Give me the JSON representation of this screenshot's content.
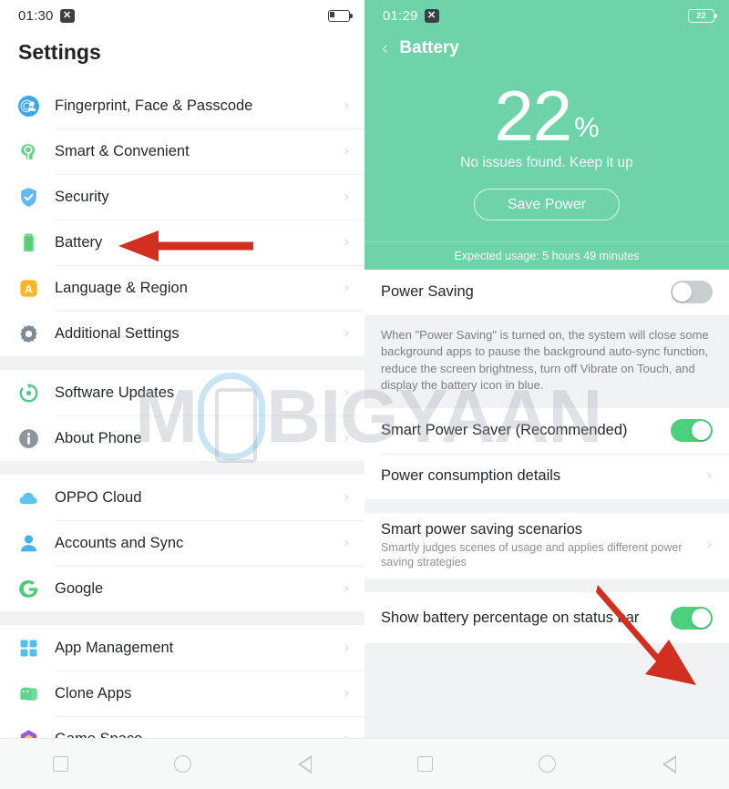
{
  "watermark": {
    "text_before": "M",
    "text_after": "BIGYAAN"
  },
  "left_screen": {
    "status_bar": {
      "time": "01:30",
      "icon": "close-x-icon",
      "battery_icon": "battery-low-icon"
    },
    "title": "Settings",
    "groups": [
      {
        "items": [
          {
            "label": "Fingerprint, Face & Passcode",
            "icon": "fingerprint-face-icon",
            "chevron": "›"
          },
          {
            "label": "Smart & Convenient",
            "icon": "smart-convenient-icon",
            "chevron": "›"
          },
          {
            "label": "Security",
            "icon": "shield-icon",
            "chevron": "›"
          },
          {
            "label": "Battery",
            "icon": "battery-icon",
            "chevron": "›"
          },
          {
            "label": "Language & Region",
            "icon": "language-icon",
            "chevron": "›"
          },
          {
            "label": "Additional Settings",
            "icon": "gear-icon",
            "chevron": "›"
          }
        ]
      },
      {
        "items": [
          {
            "label": "Software Updates",
            "icon": "refresh-icon",
            "chevron": "›"
          },
          {
            "label": "About Phone",
            "icon": "info-icon",
            "chevron": "›"
          }
        ]
      },
      {
        "items": [
          {
            "label": "OPPO Cloud",
            "icon": "cloud-icon",
            "chevron": "›"
          },
          {
            "label": "Accounts and Sync",
            "icon": "account-icon",
            "chevron": "›"
          },
          {
            "label": "Google",
            "icon": "google-icon",
            "chevron": "›"
          }
        ]
      },
      {
        "items": [
          {
            "label": "App Management",
            "icon": "app-grid-icon",
            "chevron": "›"
          },
          {
            "label": "Clone Apps",
            "icon": "clone-apps-icon",
            "chevron": "›"
          },
          {
            "label": "Game Space",
            "icon": "game-space-icon",
            "chevron": "›"
          }
        ]
      }
    ],
    "nav": {
      "recents": "recents-square-icon",
      "home": "home-circle-icon",
      "back": "back-triangle-icon"
    }
  },
  "right_screen": {
    "status_bar": {
      "time": "01:29",
      "icon": "close-x-icon",
      "battery_level": "22"
    },
    "header": {
      "back": "‹",
      "title": "Battery"
    },
    "hero": {
      "percent": "22",
      "percent_symbol": "%",
      "subtitle": "No issues found. Keep it up",
      "button_label": "Save Power",
      "expected_usage": "Expected usage: 5 hours 49 minutes",
      "bg_color": "#6ed3a9"
    },
    "rows": [
      {
        "label": "Power Saving",
        "control": "toggle",
        "state": "off"
      }
    ],
    "description": "When \"Power Saving\" is turned on, the system will close some background apps to pause the background auto-sync function, reduce the screen brightness, turn off Vibrate on Touch, and display the battery icon in blue.",
    "rows2": [
      {
        "label": "Smart Power Saver (Recommended)",
        "control": "toggle",
        "state": "on"
      },
      {
        "label": "Power consumption details",
        "control": "chevron",
        "chevron": "›"
      }
    ],
    "rows3": [
      {
        "label": "Smart power saving scenarios",
        "sub": "Smartly judges scenes of usage and applies different power saving strategies",
        "control": "chevron",
        "chevron": "›"
      }
    ],
    "rows4": [
      {
        "label": "Show battery percentage on status bar",
        "control": "toggle",
        "state": "on"
      }
    ],
    "nav": {
      "recents": "recents-square-icon",
      "home": "home-circle-icon",
      "back": "back-triangle-icon"
    }
  },
  "annotations": {
    "arrow_color": "#d32f20",
    "arrow_left_target": "Battery",
    "arrow_right_target": "Show battery percentage on status bar"
  }
}
